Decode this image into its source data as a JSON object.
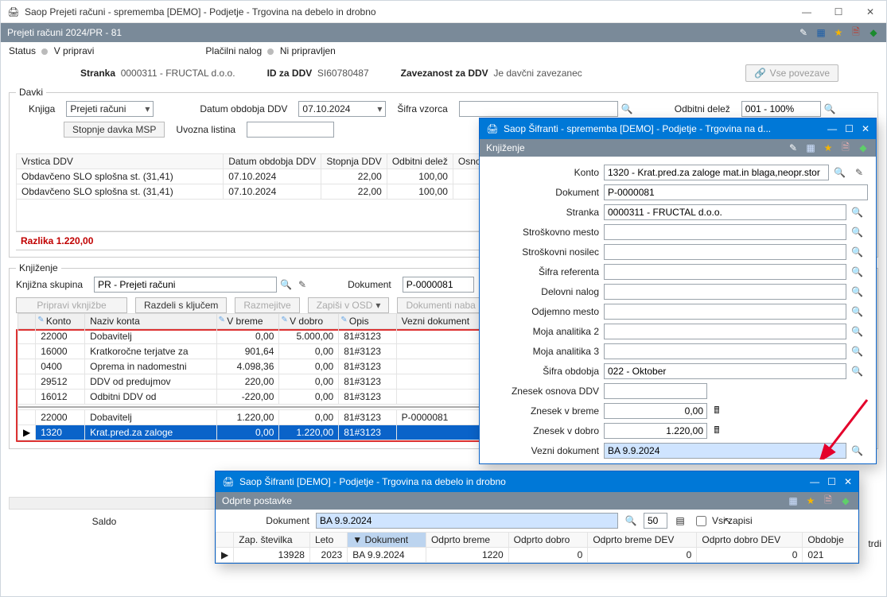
{
  "main": {
    "title": "Saop Prejeti računi - sprememba [DEMO] - Podjetje - Trgovina na debelo in drobno",
    "header": "Prejeti računi 2024/PR - 81",
    "status_label": "Status",
    "status_value": "V pripravi",
    "payorder_label": "Plačilni nalog",
    "payorder_value": "Ni pripravljen",
    "party_label": "Stranka",
    "party_value": "0000311 - FRUCTAL d.o.o.",
    "vatid_label": "ID za DDV",
    "vatid_value": "SI60780487",
    "liability_label": "Zavezanost za DDV",
    "liability_value": "Je davčni zavezanec",
    "all_links": "Vse povezave"
  },
  "taxes": {
    "legend": "Davki",
    "book_label": "Knjiga",
    "book_value": "Prejeti računi",
    "period_label": "Datum obdobja DDV",
    "period_value": "07.10.2024",
    "pattern_label": "Šifra vzorca",
    "deductible_label": "Odbitni delež",
    "deductible_value": "001 - 100%",
    "btn_msp": "Stopnje davka MSP",
    "import_label": "Uvozna listina",
    "cols": {
      "line": "Vrstica DDV",
      "period": "Datum obdobja DDV",
      "rate": "Stopnja DDV",
      "ded": "Odbitni delež",
      "base": "Osnov"
    },
    "rows": [
      {
        "line": "Obdavčeno SLO splošna st. (31,41)",
        "period": "07.10.2024",
        "rate": "22,00",
        "ded": "100,00"
      },
      {
        "line": "Obdavčeno SLO splošna st. (31,41)",
        "period": "07.10.2024",
        "rate": "22,00",
        "ded": "100,00"
      }
    ],
    "razlika": "Razlika 1.220,00"
  },
  "posting": {
    "legend": "Knjiženje",
    "group_label": "Knjižna skupina",
    "group_value": "PR - Prejeti računi",
    "doc_label": "Dokument",
    "doc_value": "P-0000081",
    "btn_prepare": "Pripravi vknjižbe",
    "btn_split": "Razdeli s ključem",
    "btn_alloc": "Razmejitve",
    "btn_osd": "Zapiši v OSD",
    "btn_purchase": "Dokumenti naba",
    "cols": {
      "konto": "Konto",
      "naziv": "Naziv konta",
      "breme": "V breme",
      "dobro": "V dobro",
      "opis": "Opis",
      "vezni": "Vezni dokument"
    },
    "rows": [
      {
        "konto": "22000",
        "naziv": "Dobavitelj",
        "breme": "0,00",
        "dobro": "5.000,00",
        "opis": "81#3123",
        "vezni": ""
      },
      {
        "konto": "16000",
        "naziv": "Kratkoročne terjatve za",
        "breme": "901,64",
        "dobro": "0,00",
        "opis": "81#3123",
        "vezni": ""
      },
      {
        "konto": "0400",
        "naziv": "Oprema in nadomestni",
        "breme": "4.098,36",
        "dobro": "0,00",
        "opis": "81#3123",
        "vezni": ""
      },
      {
        "konto": "29512",
        "naziv": "DDV od predujmov",
        "breme": "220,00",
        "dobro": "0,00",
        "opis": "81#3123",
        "vezni": ""
      },
      {
        "konto": "16012",
        "naziv": "Odbitni DDV od",
        "breme": "-220,00",
        "dobro": "0,00",
        "opis": "81#3123",
        "vezni": ""
      },
      {
        "konto": "22000",
        "naziv": "Dobavitelj",
        "breme": "1.220,00",
        "dobro": "0,00",
        "opis": "81#3123",
        "vezni": "P-0000081"
      },
      {
        "konto": "1320",
        "naziv": "Krat.pred.za zaloge",
        "breme": "0,00",
        "dobro": "1.220,00",
        "opis": "81#3123",
        "vezni": ""
      }
    ],
    "saldo_label": "Saldo"
  },
  "dlg1": {
    "title": "Saop Šifranti - sprememba [DEMO] - Podjetje - Trgovina na d...",
    "sub": "Knjiženje",
    "fields": {
      "konto_l": "Konto",
      "konto_v": "1320 - Krat.pred.za zaloge mat.in blaga,neopr.stor",
      "dokument_l": "Dokument",
      "dokument_v": "P-0000081",
      "stranka_l": "Stranka",
      "stranka_v": "0000311 - FRUCTAL d.o.o.",
      "sm_l": "Stroškovno mesto",
      "sn_l": "Stroškovni nosilec",
      "ref_l": "Šifra referenta",
      "dn_l": "Delovni nalog",
      "om_l": "Odjemno mesto",
      "ma2_l": "Moja analitika 2",
      "ma3_l": "Moja analitika 3",
      "obd_l": "Šifra obdobja",
      "obd_v": "022 - Oktober",
      "zo_l": "Znesek osnova DDV",
      "zb_l": "Znesek v breme",
      "zb_v": "0,00",
      "zd_l": "Znesek v dobro",
      "zd_v": "1.220,00",
      "vd_l": "Vezni dokument",
      "vd_v": "BA 9.9.2024"
    }
  },
  "dlg2": {
    "title": "Saop Šifranti  [DEMO] - Podjetje - Trgovina na debelo in drobno",
    "sub": "Odprte postavke",
    "doc_label": "Dokument",
    "doc_value": "BA 9.9.2024",
    "pagesize": "50",
    "all_label": "Vsi zapisi",
    "cols": {
      "zap": "Zap. številka",
      "leto": "Leto",
      "dok": "Dokument",
      "ob": "Odprto breme",
      "od": "Odprto dobro",
      "obd": "Odprto breme DEV",
      "odd": "Odprto dobro DEV",
      "per": "Obdobje"
    },
    "row": {
      "zap": "13928",
      "leto": "2023",
      "dok": "BA 9.9.2024",
      "ob": "1220",
      "od": "0",
      "obd": "0",
      "odd": "0",
      "per": "021"
    },
    "trdi": "trdi"
  }
}
